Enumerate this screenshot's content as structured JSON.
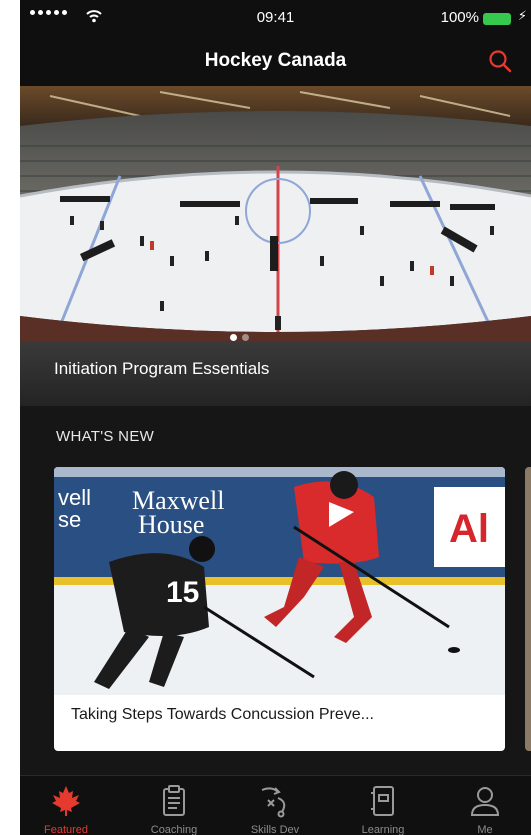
{
  "status_bar": {
    "time": "09:41",
    "battery": "100%"
  },
  "nav": {
    "title": "Hockey Canada"
  },
  "hero": {
    "caption": "Initiation Program Essentials",
    "page_count": 2,
    "active_page": 0
  },
  "whats_new": {
    "heading": "WHAT'S NEW",
    "card": {
      "title": "Taking Steps Towards Concussion Preve...",
      "banner": {
        "brand": "Maxwell",
        "brand2": "House",
        "left_text_1": "vell",
        "left_text_2": "se",
        "right_letter": "Al"
      },
      "jerseys": {
        "player1_number": "15"
      }
    }
  },
  "tabs": [
    {
      "label": "Featured",
      "icon": "maple-leaf-icon",
      "active": true
    },
    {
      "label": "Coaching",
      "icon": "clipboard-icon",
      "active": false
    },
    {
      "label": "Skills Dev",
      "icon": "play-diagram-icon",
      "active": false
    },
    {
      "label": "Learning",
      "icon": "book-icon",
      "active": false
    },
    {
      "label": "Me",
      "icon": "person-icon",
      "active": false
    }
  ],
  "colors": {
    "accent": "#e63a2e",
    "background": "#161616",
    "battery": "#36c94e"
  }
}
